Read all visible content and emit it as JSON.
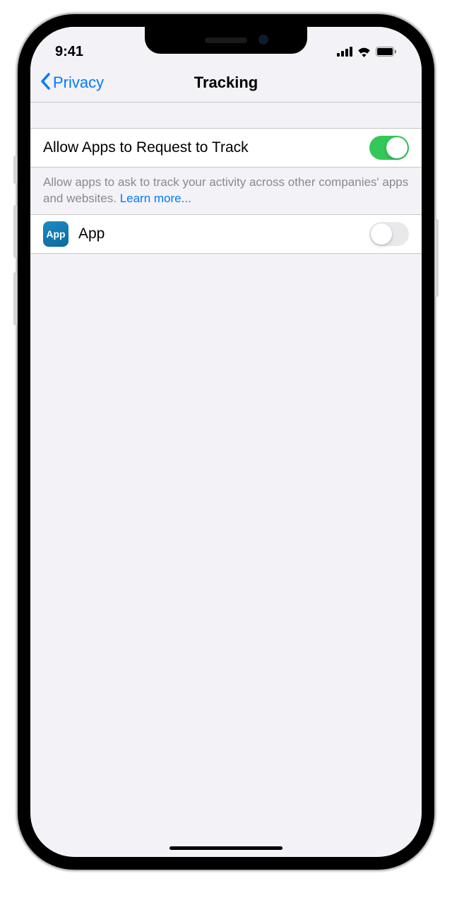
{
  "statusBar": {
    "time": "9:41"
  },
  "nav": {
    "backLabel": "Privacy",
    "title": "Tracking"
  },
  "mainToggle": {
    "label": "Allow Apps to Request to Track",
    "enabled": true
  },
  "footer": {
    "text": "Allow apps to ask to track your activity across other companies' apps and websites. ",
    "linkText": "Learn more..."
  },
  "apps": [
    {
      "iconText": "App",
      "name": "App",
      "enabled": false
    }
  ]
}
